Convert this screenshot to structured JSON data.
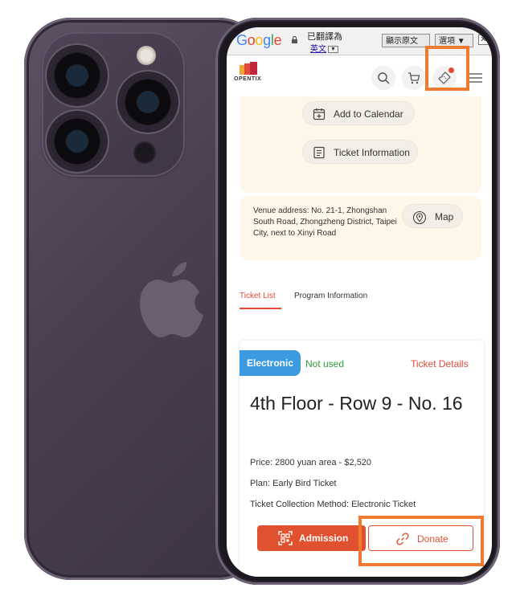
{
  "google_bar": {
    "logo": [
      "G",
      "o",
      "o",
      "g",
      "l",
      "e"
    ],
    "translated_label": "已翻譯為",
    "language": "英文",
    "language_arrow": "▼",
    "show_original": "顯示原文",
    "options": "選項 ▼",
    "close": "✕"
  },
  "header": {
    "brand": "OPENTIX",
    "icons": [
      "search-icon",
      "cart-icon",
      "ticket-icon",
      "menu-icon"
    ],
    "notification": true
  },
  "event_actions": {
    "add_to_calendar": "Add to Calendar",
    "ticket_information": "Ticket Information"
  },
  "venue": {
    "address": "Venue address: No. 21-1, Zhongshan South Road, Zhongzheng District, Taipei City, next to Xinyi Road",
    "map": "Map"
  },
  "tabs": {
    "ticket_list": "Ticket List",
    "program_information": "Program Information"
  },
  "ticket": {
    "type_badge": "Electronic",
    "status": "Not used",
    "details_link": "Ticket Details",
    "seat": "4th Floor - Row 9 - No. 16",
    "price": "Price: 2800 yuan area - $2,520",
    "plan": "Plan: Early Bird Ticket",
    "collection": "Ticket Collection Method: Electronic Ticket",
    "admission": "Admission",
    "donate": "Donate"
  },
  "colors": {
    "accent": "#e24b36",
    "highlight": "#f07a2e",
    "badge": "#3c9be0",
    "status_green": "#2e9d3a",
    "cream": "#fdf6e9"
  }
}
